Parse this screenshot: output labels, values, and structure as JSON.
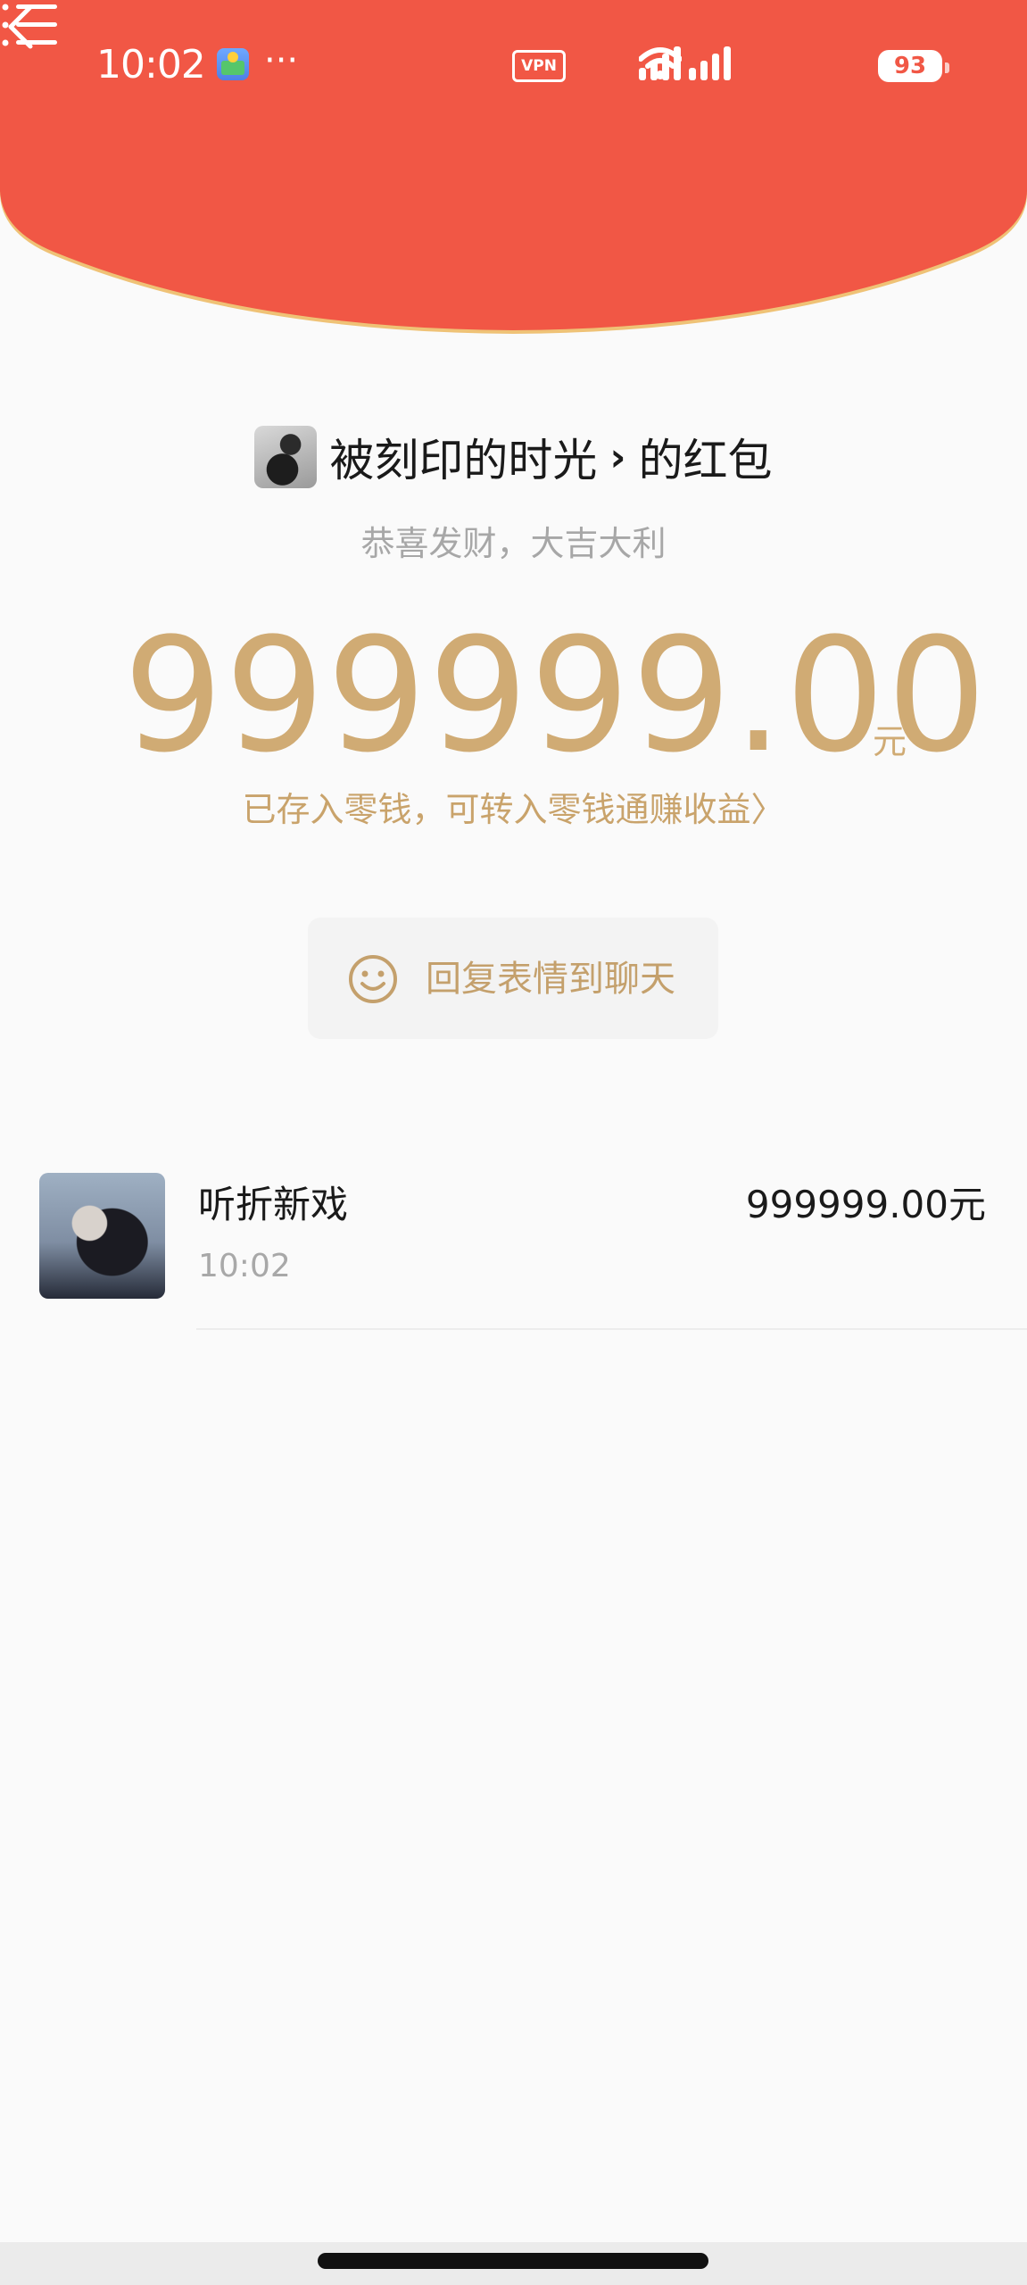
{
  "status_bar": {
    "time": "10:02",
    "more": "···",
    "vpn": "VPN",
    "battery": "93"
  },
  "colors": {
    "header_red": "#f15745",
    "gold": "#d0ab74",
    "gold_text": "#c9a36b"
  },
  "header": {
    "back_icon": "chevron-left",
    "menu_icon": "list-menu"
  },
  "envelope": {
    "sender_name": "被刻印的时光",
    "chevron": "›",
    "suffix": "的红包",
    "greeting": "恭喜发财，大吉大利",
    "amount": "999999.00",
    "unit": "元",
    "deposit_note": "已存入零钱，可转入零钱通赚收益〉",
    "reply_label": "回复表情到聊天"
  },
  "receivers": [
    {
      "name": "听折新戏",
      "time": "10:02",
      "amount": "999999.00元"
    }
  ]
}
